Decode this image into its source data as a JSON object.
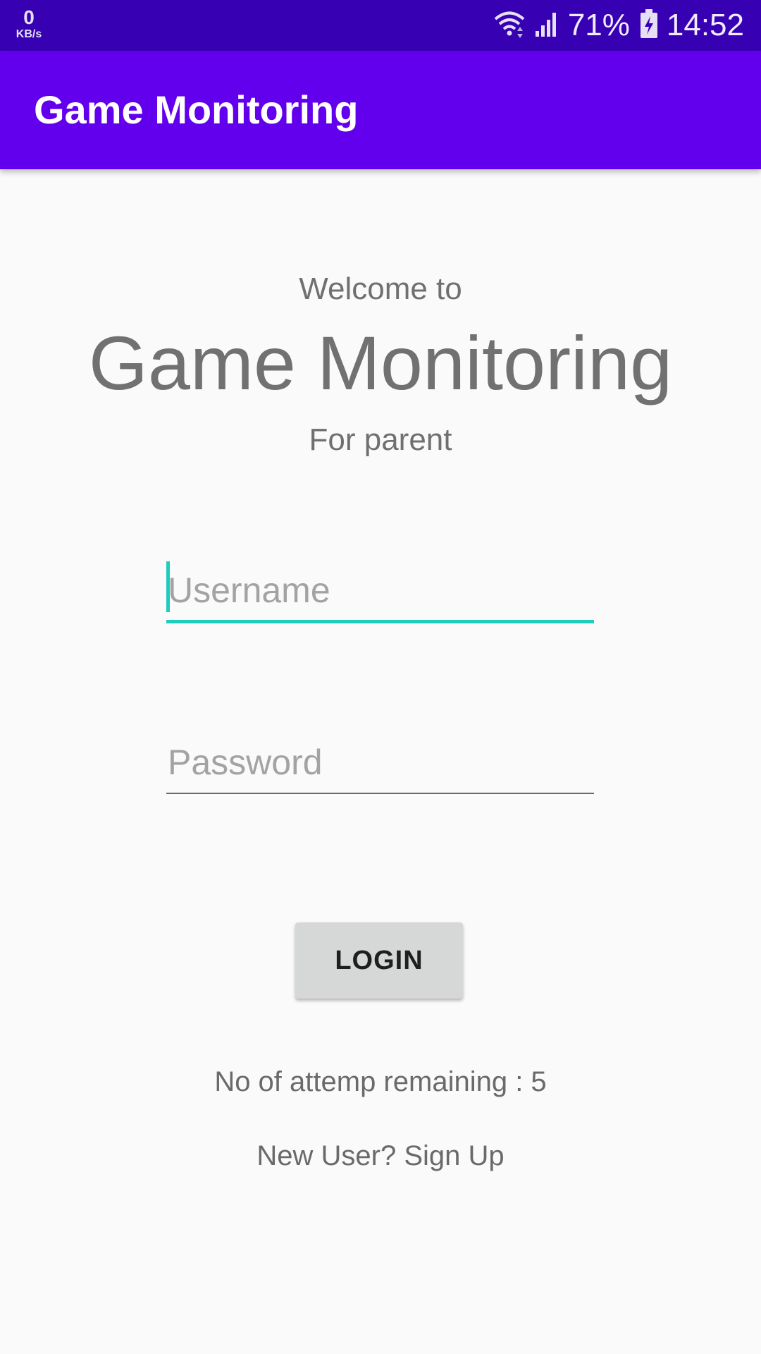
{
  "status_bar": {
    "net_speed_value": "0",
    "net_speed_unit": "KB/s",
    "battery_percent": "71%",
    "time": "14:52",
    "icons": [
      "wifi-icon",
      "signal-icon",
      "battery-charging-icon"
    ]
  },
  "app_bar": {
    "title": "Game Monitoring"
  },
  "welcome": {
    "line1": "Welcome to",
    "title": "Game Monitoring",
    "subtitle": "For parent"
  },
  "form": {
    "username_placeholder": "Username",
    "username_value": "",
    "password_placeholder": "Password",
    "password_value": "",
    "login_label": "LOGIN"
  },
  "footer": {
    "attempts_text": "No of attemp remaining : 5",
    "signup_text": "New User? Sign Up"
  },
  "colors": {
    "status_bar": "#3700b3",
    "app_bar": "#6200ee",
    "accent": "#1fcdbe",
    "background": "#fafafa"
  }
}
